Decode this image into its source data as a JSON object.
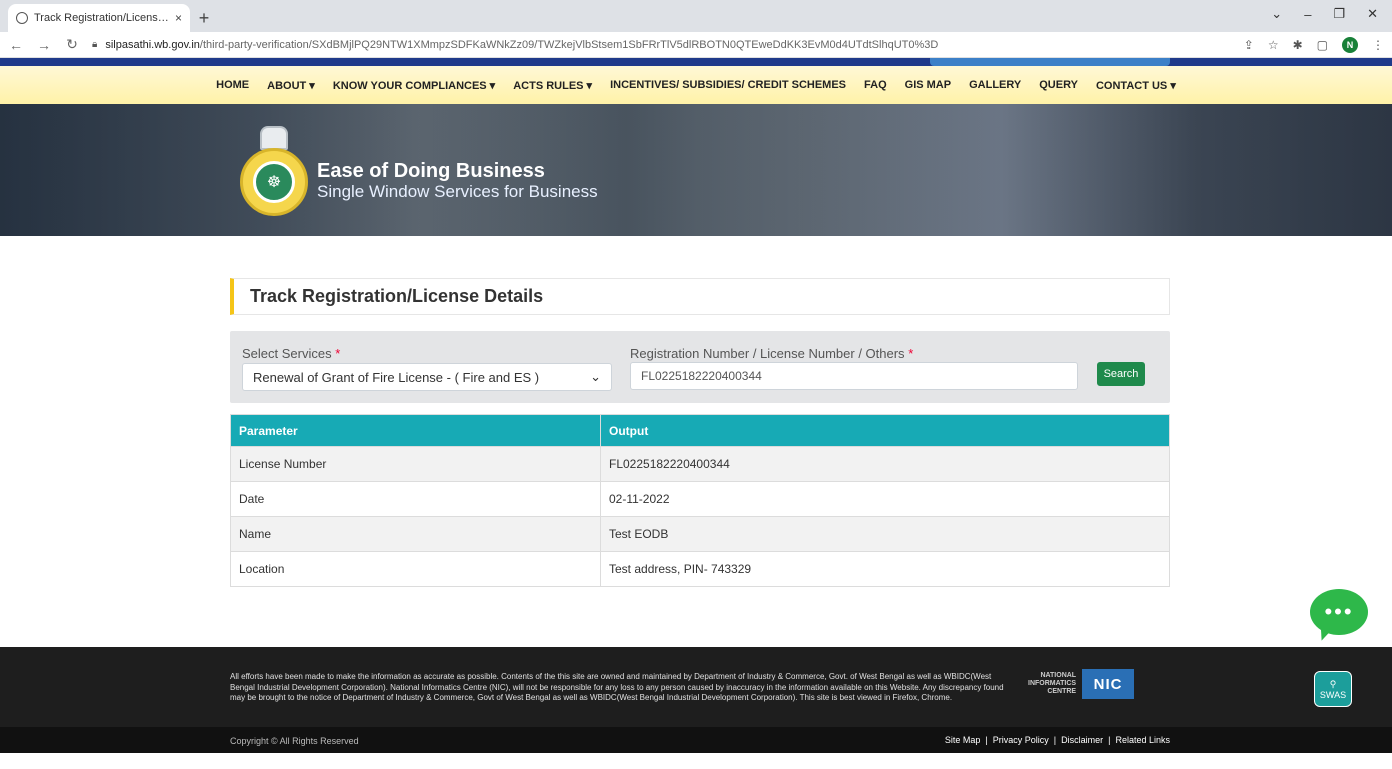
{
  "browser": {
    "tab_title": "Track Registration/License Detail",
    "tab_close": "×",
    "new_tab": "+",
    "url_domain": "silpasathi.wb.gov.in",
    "url_path": "/third-party-verification/SXdBMjlPQ29NTW1XMmpzSDFKaWNkZz09/TWZkejVlbStsem1SbFRrTlV5dlRBOTN0QTEweDdKK3EvM0d4UTdtSlhqUT0%3D",
    "profile_initial": "N"
  },
  "menu": {
    "items": [
      "HOME",
      "ABOUT ▾",
      "KNOW YOUR COMPLIANCES ▾",
      "ACTS RULES ▾",
      "INCENTIVES/ SUBSIDIES/ CREDIT SCHEMES",
      "FAQ",
      "GIS MAP",
      "GALLERY",
      "QUERY",
      "CONTACT US ▾"
    ]
  },
  "hero": {
    "title": "Ease of Doing Business",
    "subtitle": "Single Window Services for Business"
  },
  "page": {
    "title": "Track Registration/License Details"
  },
  "filter": {
    "services_label": "Select Services",
    "services_value": "Renewal of Grant of Fire License - ( Fire and ES )",
    "number_label": "Registration Number / License Number / Others",
    "number_value": "FL0225182220400344",
    "required_mark": "*",
    "search_label": "Search"
  },
  "results": {
    "headers": [
      "Parameter",
      "Output"
    ],
    "rows": [
      {
        "param": "License Number",
        "output": "FL0225182220400344"
      },
      {
        "param": "Date",
        "output": "02-11-2022"
      },
      {
        "param": "Name",
        "output": "Test EODB"
      },
      {
        "param": "Location",
        "output": "Test address, PIN- 743329"
      }
    ]
  },
  "chat": {
    "glyph": "•••"
  },
  "footer": {
    "disclaimer": "All efforts have been made to make the information as accurate as possible. Contents of the this site are owned and maintained by Department of Industry & Commerce, Govt. of West Bengal as well as WBIDC(West Bengal Industrial Development Corporation). National Informatics Centre (NIC), will not be responsible for any loss to any person caused by inaccuracy in the information available on this Website. Any discrepancy found may be brought to the notice of Department of Industry & Commerce, Govt of West Bengal as well as WBIDC(West Bengal Industrial Development Corporation). This site is best viewed in Firefox, Chrome.",
    "nic_line1": "NATIONAL",
    "nic_line2": "INFORMATICS",
    "nic_line3": "CENTRE",
    "nic_logo": "NIC",
    "swas_label": "SWAS",
    "copyright": "Copyright © All Rights Reserved",
    "links": [
      "Site Map",
      "Privacy Policy",
      "Disclaimer",
      "Related Links"
    ]
  },
  "colors": {
    "table_header": "#17aab5",
    "search_button": "#1f8a4c",
    "accent_bar": "#f5c518",
    "chat": "#2eb84a"
  }
}
